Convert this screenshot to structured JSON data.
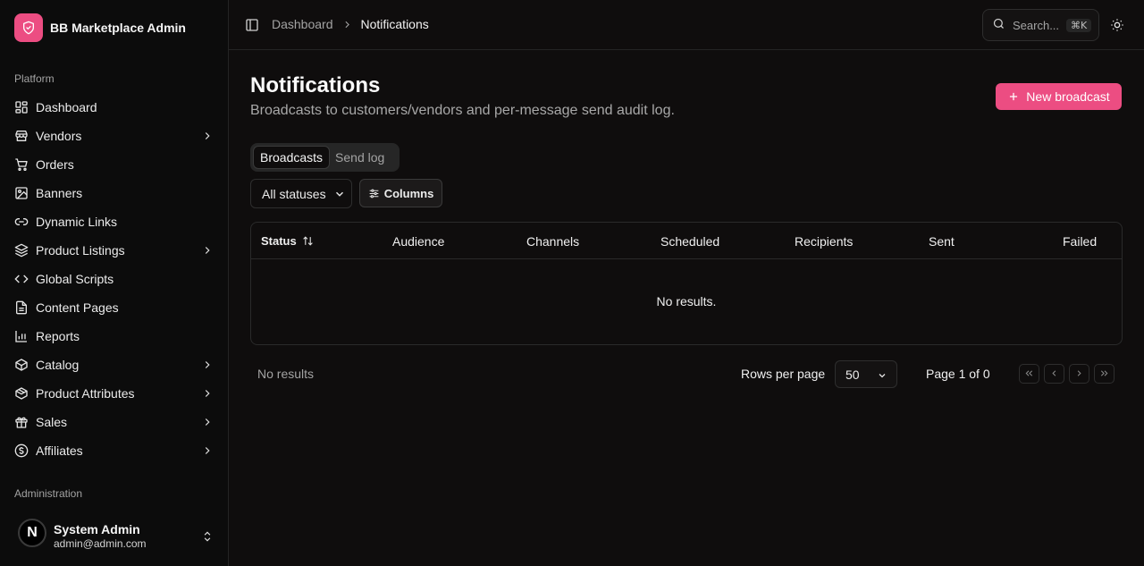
{
  "app": {
    "name": "BB Marketplace Admin"
  },
  "colors": {
    "accent": "#ec4d82",
    "background": "#0f0d0d",
    "sidebar": "#0c0c0c"
  },
  "sidebar": {
    "platform_label": "Platform",
    "admin_label": "Administration",
    "items": [
      {
        "label": "Dashboard",
        "icon": "dashboard-icon",
        "has_submenu": false
      },
      {
        "label": "Vendors",
        "icon": "store-icon",
        "has_submenu": true
      },
      {
        "label": "Orders",
        "icon": "cart-icon",
        "has_submenu": false
      },
      {
        "label": "Banners",
        "icon": "image-icon",
        "has_submenu": false
      },
      {
        "label": "Dynamic Links",
        "icon": "link-icon",
        "has_submenu": false
      },
      {
        "label": "Product Listings",
        "icon": "layers-icon",
        "has_submenu": true
      },
      {
        "label": "Global Scripts",
        "icon": "code-icon",
        "has_submenu": false
      },
      {
        "label": "Content Pages",
        "icon": "file-icon",
        "has_submenu": false
      },
      {
        "label": "Reports",
        "icon": "bar-chart-icon",
        "has_submenu": false
      },
      {
        "label": "Catalog",
        "icon": "box-icon",
        "has_submenu": true
      },
      {
        "label": "Product Attributes",
        "icon": "package-icon",
        "has_submenu": true
      },
      {
        "label": "Sales",
        "icon": "gift-icon",
        "has_submenu": true
      },
      {
        "label": "Affiliates",
        "icon": "dollar-circle-icon",
        "has_submenu": true
      }
    ],
    "user": {
      "initial": "N",
      "name": "System Admin",
      "email": "admin@admin.com"
    }
  },
  "topbar": {
    "breadcrumb": {
      "parent": "Dashboard",
      "current": "Notifications"
    },
    "search_placeholder": "Search...",
    "search_shortcut": "⌘K"
  },
  "page": {
    "title": "Notifications",
    "subtitle": "Broadcasts to customers/vendors and per-message send audit log.",
    "primary_action": "New broadcast"
  },
  "tabs": [
    {
      "label": "Broadcasts",
      "active": true
    },
    {
      "label": "Send log",
      "active": false
    }
  ],
  "filters": {
    "status_value": "All statuses",
    "columns_label": "Columns"
  },
  "table": {
    "columns": [
      "Status",
      "Audience",
      "Channels",
      "Scheduled",
      "Recipients",
      "Sent",
      "Failed"
    ],
    "empty_text": "No results."
  },
  "pagination": {
    "summary": "No results",
    "rows_per_page_label": "Rows per page",
    "rows_per_page_value": "50",
    "page_info": "Page 1 of 0"
  }
}
